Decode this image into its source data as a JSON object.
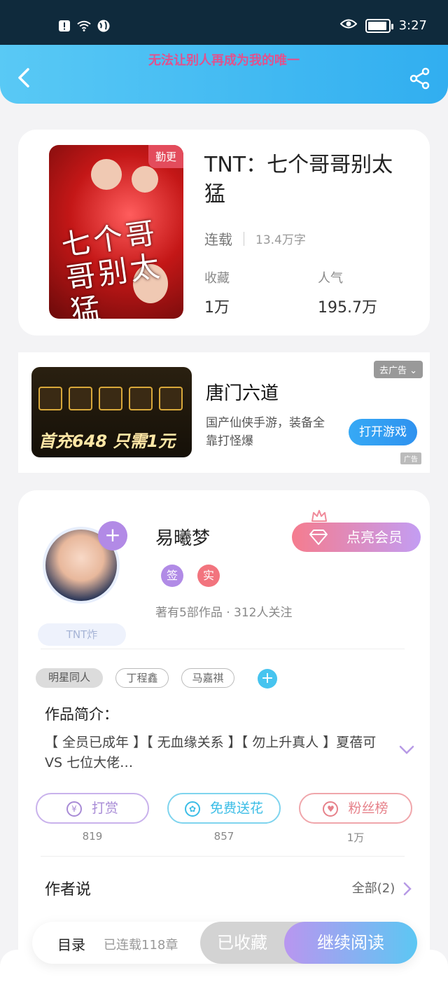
{
  "status_bar": {
    "time": "3:27"
  },
  "header": {
    "marquee": "无法让别人再成为我的唯一"
  },
  "book": {
    "badge": "勤更",
    "cover_text": "七个哥哥别太猛",
    "title": "TNT：七个哥哥别太猛",
    "status": "连载",
    "word_count": "13.4万字",
    "collect_label": "收藏",
    "collect_value": "1万",
    "popularity_label": "人气",
    "popularity_value": "195.7万"
  },
  "ad": {
    "close_label": "去广告",
    "promo_text": "首充648 只需1元",
    "title": "唐门六道",
    "description": "国产仙侠手游，装备全靠打怪爆",
    "button_label": "打开游戏",
    "tag": "广告"
  },
  "author": {
    "name": "易曦梦",
    "vip_button": "点亮会员",
    "cert_sign": "签",
    "cert_real": "实",
    "stats": "著有5部作品 · 312人关注",
    "fan_badge": "TNT炸",
    "tags": [
      "明星同人",
      "丁程鑫",
      "马嘉祺"
    ],
    "intro_label": "作品简介：",
    "intro_text": "【 全员已成年 】【 无血缘关系 】【 勿上升真人 】夏蓓可 VS 七位大佬…",
    "actions": [
      {
        "label": "打赏",
        "count": "819"
      },
      {
        "label": "免费送花",
        "count": "857"
      },
      {
        "label": "粉丝榜",
        "count": "1万"
      }
    ],
    "author_says_label": "作者说",
    "all_link": "全部(2)"
  },
  "bottom_bar": {
    "toc_label": "目录",
    "chapter_count": "已连载118章",
    "collected_label": "已收藏",
    "continue_label": "继续阅读"
  }
}
